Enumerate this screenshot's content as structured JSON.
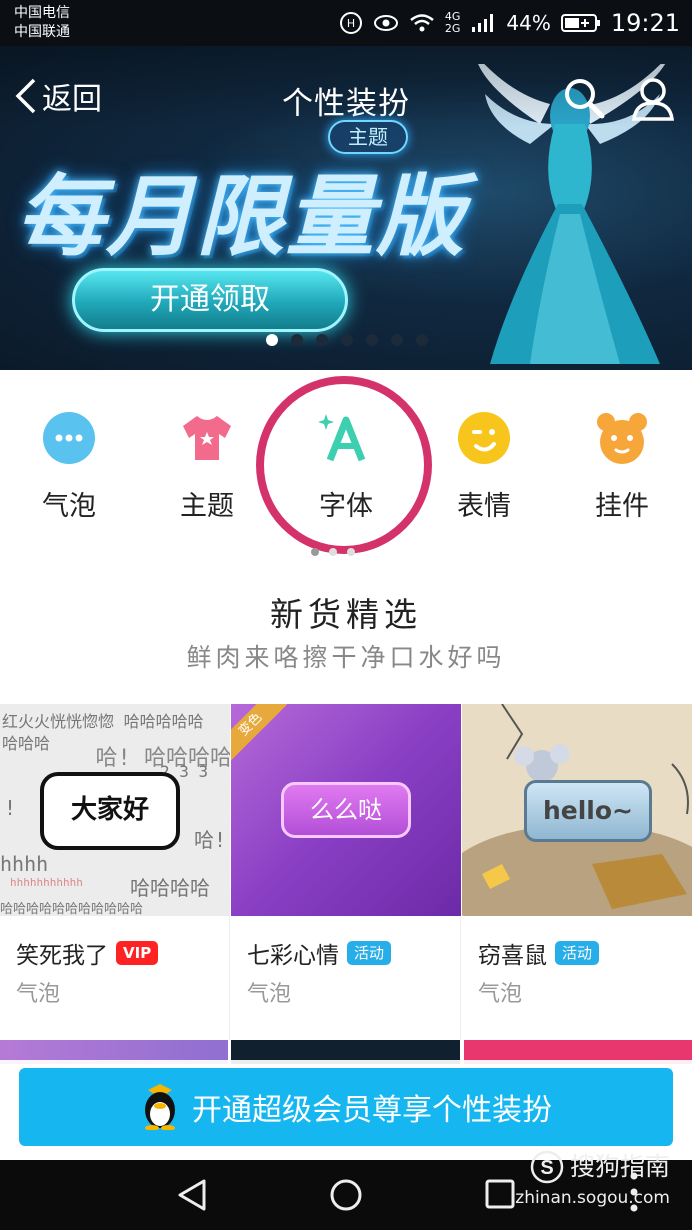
{
  "status": {
    "carrier1": "中国电信",
    "carrier2": "中国联通",
    "network1": "4G",
    "network2": "2G",
    "battery": "44%",
    "time": "19:21"
  },
  "header": {
    "back_label": "返回",
    "title": "个性装扮"
  },
  "banner": {
    "tag": "主题",
    "headline": "每月限量版",
    "cta": "开通领取",
    "dot_count": 7,
    "active_dot": 0
  },
  "categories": [
    {
      "label": "气泡",
      "icon": "bubble-icon"
    },
    {
      "label": "主题",
      "icon": "theme-shirt-icon"
    },
    {
      "label": "字体",
      "icon": "font-icon"
    },
    {
      "label": "表情",
      "icon": "emoji-icon"
    },
    {
      "label": "挂件",
      "icon": "pendant-icon"
    }
  ],
  "section": {
    "title": "新货精选",
    "subtitle": "鲜肉来咯擦干净口水好吗"
  },
  "cards": [
    {
      "name": "笑死我了",
      "badge": "VIP",
      "category": "气泡",
      "bubble_text": "大家好"
    },
    {
      "name": "七彩心情",
      "badge": "活动",
      "category": "气泡",
      "bubble_text": "么么哒",
      "ribbon": "变色"
    },
    {
      "name": "窃喜鼠",
      "badge": "活动",
      "category": "气泡",
      "bubble_text": "hello~"
    }
  ],
  "card1_bg_text": [
    "红火火恍恍惚惚 哈哈哈哈哈",
    "哈哈哈",
    "哈! 哈哈哈哈",
    "2 3 3",
    "!",
    "哈!",
    "hhhh",
    "哈哈哈哈",
    "hhhhhhhhhhh",
    "哈哈哈哈哈哈哈哈哈哈哈"
  ],
  "bottom_cta": {
    "label": "开通超级会员尊享个性装扮"
  },
  "watermark": {
    "brand": "搜狗指南",
    "url": "zhinan.sogou.com"
  },
  "colors": {
    "accent": "#16b7f0",
    "highlight": "#d4326b",
    "vip": "#ff2222",
    "activity": "#27aee8"
  }
}
